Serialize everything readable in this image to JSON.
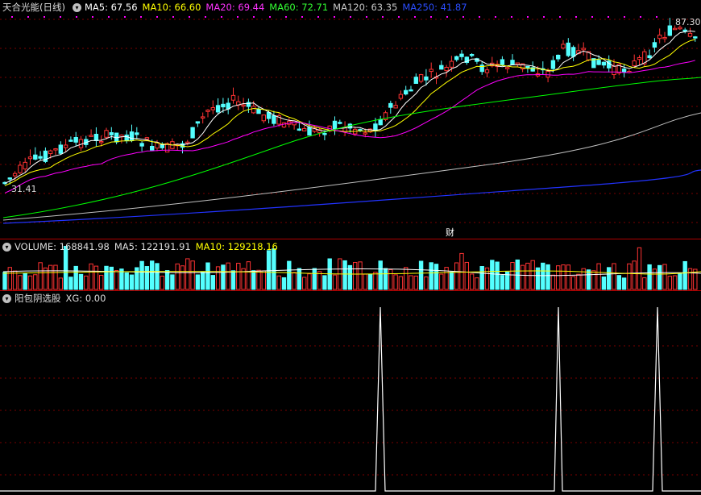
{
  "main": {
    "title": "天合光能(日线)",
    "ma5": {
      "label": "MA5: 67.56",
      "color": "#ffffff"
    },
    "ma10": {
      "label": "MA10: 66.60",
      "color": "#ffff00"
    },
    "ma20": {
      "label": "MA20: 69.44",
      "color": "#ff00ff"
    },
    "ma60": {
      "label": "MA60: 72.71",
      "color": "#00ff00"
    },
    "ma120": {
      "label": "MA120: 63.35",
      "color": "#c0c0c0"
    },
    "ma250": {
      "label": "MA250: 41.87",
      "color": "#0033ff"
    },
    "high_price_label": "87.30",
    "low_price_label": "31.41",
    "event_marker": "财"
  },
  "volume": {
    "title": "VOLUME: 168841.98",
    "ma5": "MA5: 122191.91",
    "ma10": "MA10: 129218.16"
  },
  "indicator": {
    "title": "阳包阴选股",
    "xg": "XG: 0.00"
  },
  "colors": {
    "up": "#ff3333",
    "down": "#54ffff",
    "grid": "#7a0000",
    "separator": "#b00000",
    "signal": "#ffffff"
  },
  "chart_data": {
    "type": "candlestick",
    "y_range_visible": [
      31.41,
      87.3
    ],
    "moving_averages": [
      "MA5",
      "MA10",
      "MA20",
      "MA60",
      "MA120",
      "MA250"
    ],
    "signal_spikes_count": 3
  }
}
